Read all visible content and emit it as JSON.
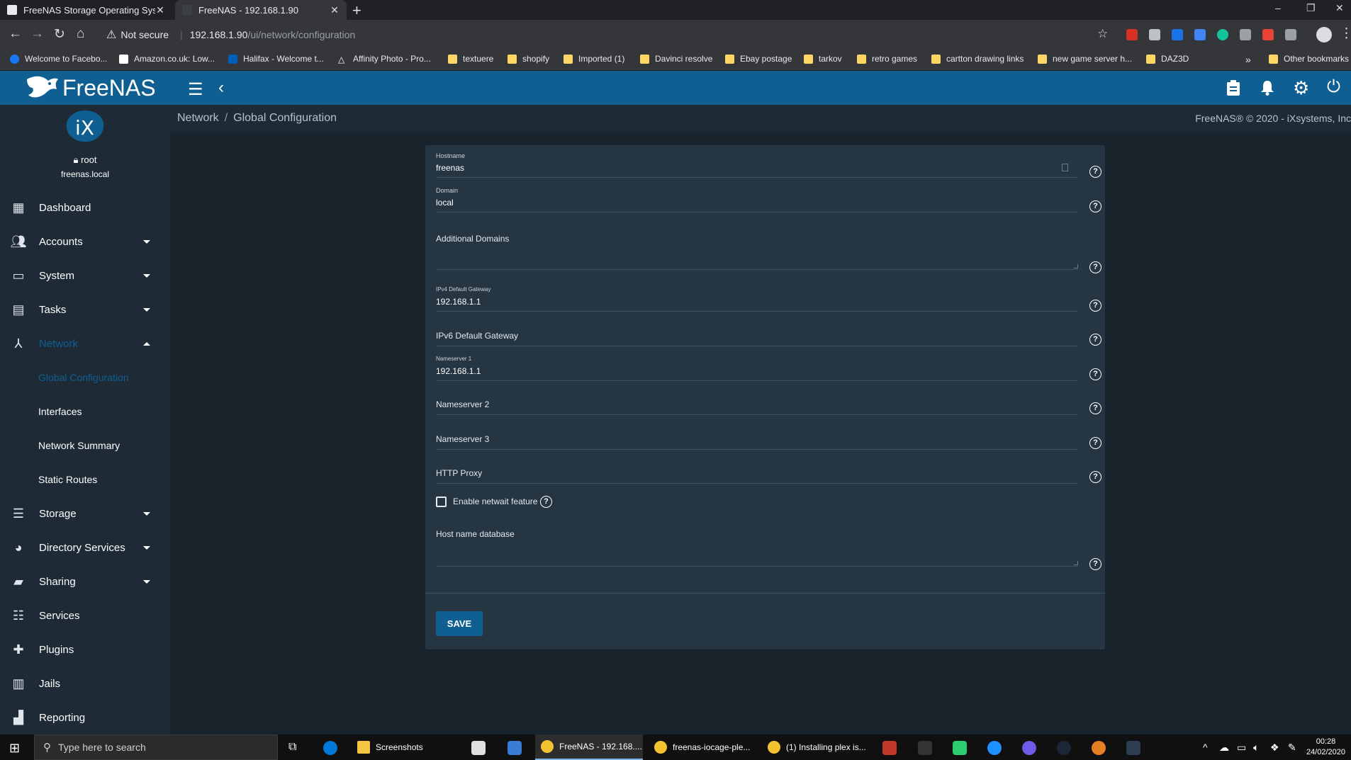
{
  "browser": {
    "tabs": [
      {
        "title": "FreeNAS Storage Operating Syst",
        "active": false
      },
      {
        "title": "FreeNAS - 192.168.1.90",
        "active": true
      }
    ],
    "new_tab": "+",
    "window_controls": [
      "–",
      "❐",
      "✕"
    ],
    "nav": {
      "back": "←",
      "forward": "→",
      "reload": "↻",
      "home": "⌂"
    },
    "security_label": "Not secure",
    "url_host": "192.168.1.90",
    "url_path": "/ui/network/configuration",
    "bookmarks": [
      "Welcome to Facebo...",
      "Amazon.co.uk: Low...",
      "Halifax - Welcome t...",
      "Affinity Photo - Pro...",
      "textuere",
      "shopify",
      "Imported (1)",
      "Davinci resolve",
      "Ebay postage",
      "tarkov",
      "retro games",
      "cartton drawing links",
      "new game server h...",
      "DAZ3D"
    ],
    "bookmarks_overflow": "»",
    "other_bookmarks": "Other bookmarks"
  },
  "app": {
    "brand": "FreeNAS",
    "user": {
      "name": "root",
      "host": "freenas.local"
    },
    "breadcrumb": [
      "Network",
      "Global Configuration"
    ],
    "copyright": "FreeNAS® © 2020 - iXsystems, Inc",
    "nav": [
      {
        "label": "Dashboard",
        "icon": "dashboard-icon",
        "caret": ""
      },
      {
        "label": "Accounts",
        "icon": "accounts-icon",
        "caret": "down"
      },
      {
        "label": "System",
        "icon": "laptop-icon",
        "caret": "down"
      },
      {
        "label": "Tasks",
        "icon": "calendar-icon",
        "caret": "down"
      },
      {
        "label": "Network",
        "icon": "network-icon",
        "caret": "up",
        "active": true
      },
      {
        "label": "Storage",
        "icon": "storage-icon",
        "caret": "down"
      },
      {
        "label": "Directory Services",
        "icon": "directory-icon",
        "caret": "down"
      },
      {
        "label": "Sharing",
        "icon": "folder-share-icon",
        "caret": "down"
      },
      {
        "label": "Services",
        "icon": "tune-icon",
        "caret": ""
      },
      {
        "label": "Plugins",
        "icon": "puzzle-icon",
        "caret": ""
      },
      {
        "label": "Jails",
        "icon": "jail-icon",
        "caret": ""
      },
      {
        "label": "Reporting",
        "icon": "chart-icon",
        "caret": ""
      }
    ],
    "network_subnav": [
      {
        "label": "Global Configuration",
        "active": true
      },
      {
        "label": "Interfaces"
      },
      {
        "label": "Network Summary"
      },
      {
        "label": "Static Routes"
      }
    ]
  },
  "form": {
    "hostname": {
      "label": "Hostname",
      "value": "freenas"
    },
    "domain": {
      "label": "Domain",
      "value": "local"
    },
    "additional_domains": {
      "label": "Additional Domains",
      "value": ""
    },
    "ipv4_gateway": {
      "label": "IPv4 Default Gateway",
      "value": "192.168.1.1"
    },
    "ipv6_gateway": {
      "label": "IPv6 Default Gateway",
      "value": ""
    },
    "nameserver1": {
      "label": "Nameserver 1",
      "value": "192.168.1.1"
    },
    "nameserver2": {
      "label": "Nameserver 2",
      "value": ""
    },
    "nameserver3": {
      "label": "Nameserver 3",
      "value": ""
    },
    "http_proxy": {
      "label": "HTTP Proxy",
      "value": ""
    },
    "netwait": {
      "label": "Enable netwait feature",
      "checked": false
    },
    "host_db": {
      "label": "Host name database",
      "value": ""
    },
    "help_glyph": "?",
    "save_label": "SAVE"
  },
  "taskbar": {
    "search_placeholder": "Type here to search",
    "items": [
      {
        "label": "Screenshots"
      },
      {
        "label": "FreeNAS - 192.168...."
      },
      {
        "label": "freenas-iocage-ple..."
      },
      {
        "label": "(1) Installing plex is..."
      }
    ],
    "time": "00:28",
    "date": "24/02/2020"
  },
  "colors": {
    "brand_blue": "#0f5f92",
    "sidebar_bg": "#1e2a35",
    "card_bg": "#253542",
    "content_bg": "#18232c"
  }
}
